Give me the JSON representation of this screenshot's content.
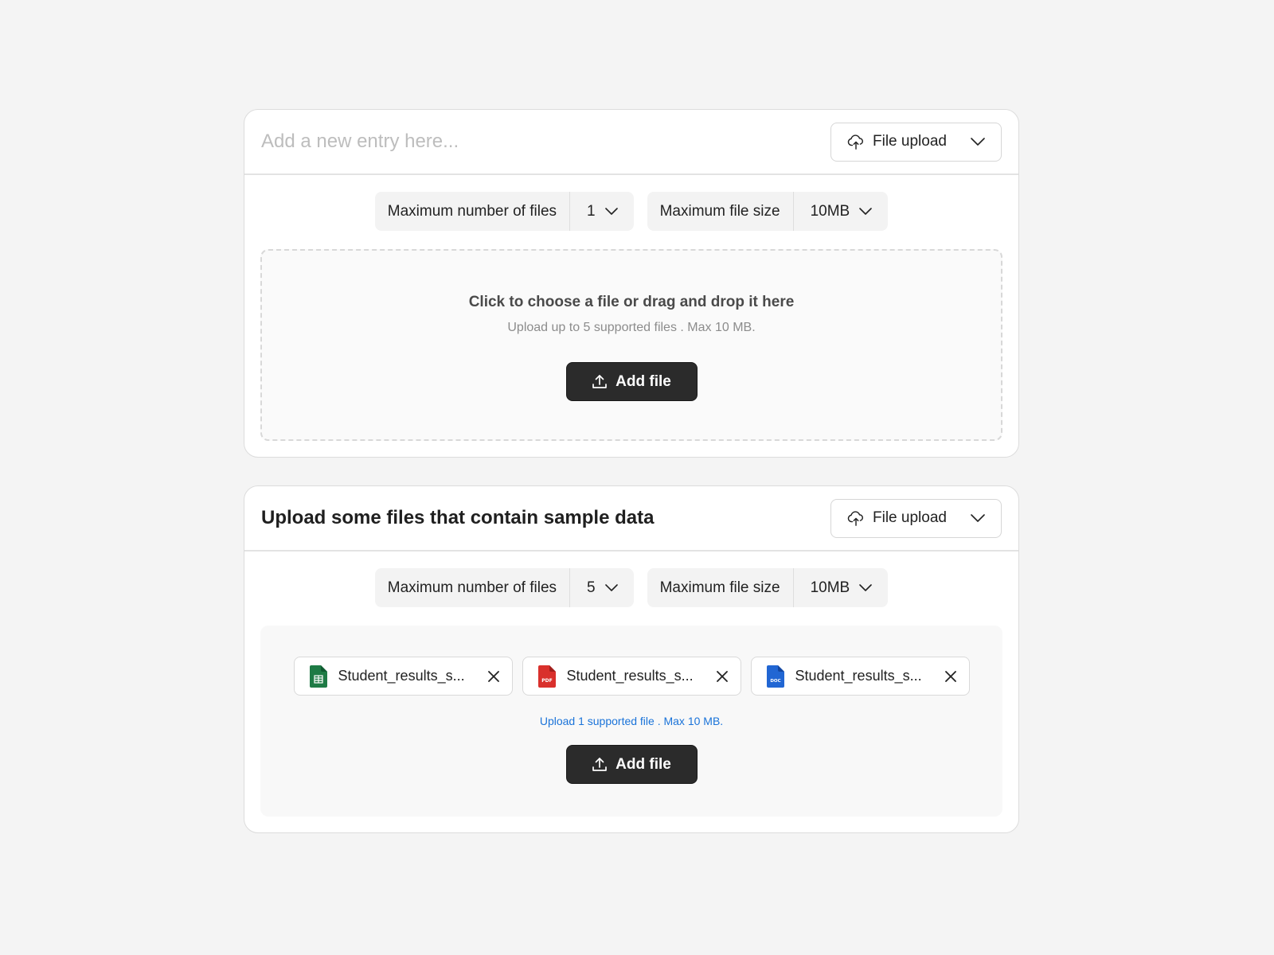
{
  "colors": {
    "background": "#f4f4f4",
    "card": "#ffffff",
    "primary_button": "#2b2b2b",
    "info_text": "#1a73d9",
    "sheet_icon": "#1e7b45",
    "pdf_icon": "#d9302c",
    "doc_icon": "#2166d3"
  },
  "card1": {
    "entry_placeholder": "Add a new entry here...",
    "type_dropdown": {
      "label": "File upload",
      "icon": "cloud-upload-icon"
    },
    "max_files": {
      "label": "Maximum number of files",
      "value": "1"
    },
    "max_size": {
      "label": "Maximum file size",
      "value": "10MB"
    },
    "dropzone": {
      "title": "Click to choose a file or drag and drop it here",
      "subtitle": "Upload up to 5 supported files . Max 10 MB."
    },
    "add_button": "Add file"
  },
  "card2": {
    "title": "Upload some files that contain sample data",
    "type_dropdown": {
      "label": "File upload",
      "icon": "cloud-upload-icon"
    },
    "max_files": {
      "label": "Maximum number of files",
      "value": "5"
    },
    "max_size": {
      "label": "Maximum file size",
      "value": "10MB"
    },
    "files": [
      {
        "name": "Student_results_s...",
        "type": "sheet",
        "icon": "spreadsheet-file-icon"
      },
      {
        "name": "Student_results_s...",
        "type": "pdf",
        "icon": "pdf-file-icon"
      },
      {
        "name": "Student_results_s...",
        "type": "doc",
        "icon": "doc-file-icon"
      }
    ],
    "note": "Upload 1 supported file . Max 10 MB.",
    "add_button": "Add file"
  }
}
